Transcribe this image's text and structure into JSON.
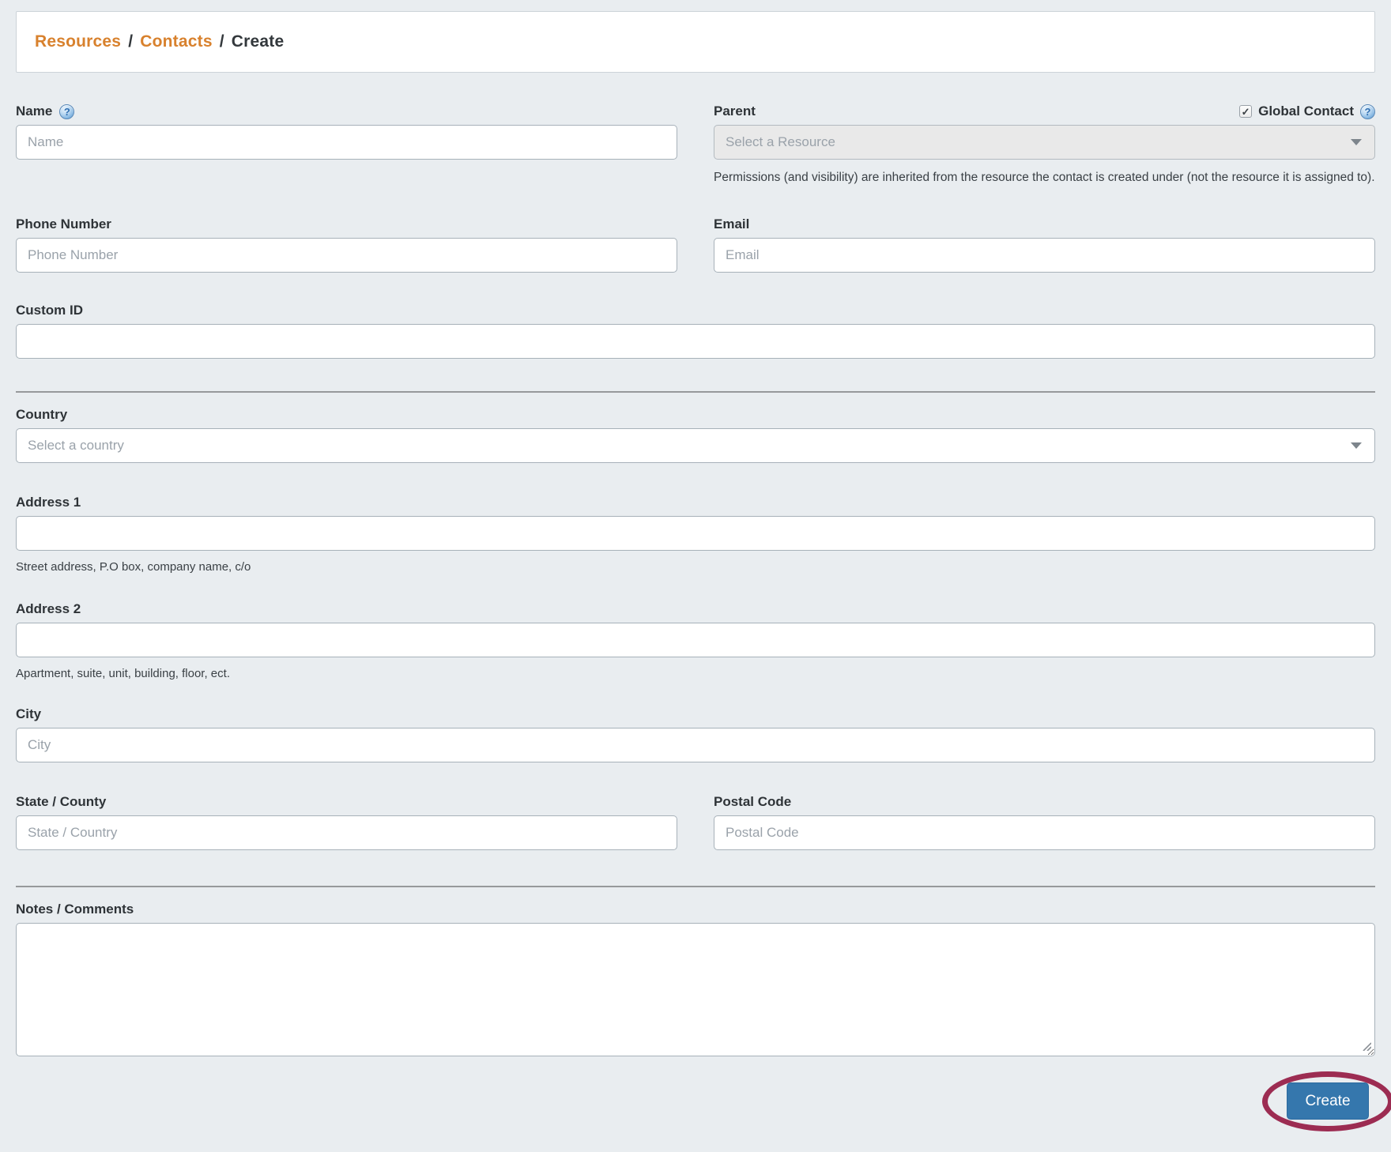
{
  "breadcrumb": {
    "resources": "Resources",
    "contacts": "Contacts",
    "create": "Create",
    "separator": "/"
  },
  "form": {
    "name": {
      "label": "Name",
      "placeholder": "Name"
    },
    "parent": {
      "label": "Parent",
      "value": "Select a Resource",
      "note": "Permissions (and visibility) are inherited from the resource the contact is created under (not the resource it is assigned to)."
    },
    "global_contact": {
      "label": "Global Contact",
      "checked": true
    },
    "phone": {
      "label": "Phone Number",
      "placeholder": "Phone Number"
    },
    "email": {
      "label": "Email",
      "placeholder": "Email"
    },
    "custom_id": {
      "label": "Custom ID",
      "value": ""
    },
    "country": {
      "label": "Country",
      "value": "Select a country"
    },
    "address1": {
      "label": "Address 1",
      "value": "",
      "helper": "Street address, P.O box, company name, c/o"
    },
    "address2": {
      "label": "Address 2",
      "value": "",
      "helper": "Apartment, suite, unit, building, floor, ect."
    },
    "city": {
      "label": "City",
      "placeholder": "City"
    },
    "state": {
      "label": "State / County",
      "placeholder": "State / Country"
    },
    "postal": {
      "label": "Postal Code",
      "placeholder": "Postal Code"
    },
    "notes": {
      "label": "Notes / Comments",
      "value": ""
    },
    "submit": {
      "label": "Create"
    }
  },
  "icons": {
    "help_glyph": "?",
    "check_glyph": "✓"
  },
  "colors": {
    "page_background": "#e9edf0",
    "breadcrumb_link": "#d8812d",
    "button_blue": "#3577ad",
    "annotation_maroon": "#9c2c52",
    "divider_gray": "#97999b"
  }
}
